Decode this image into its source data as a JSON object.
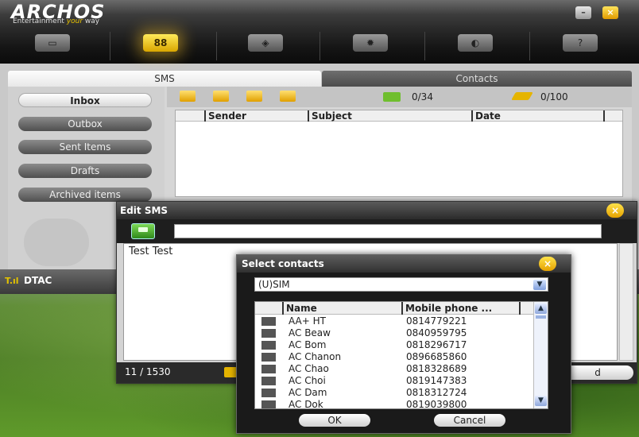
{
  "app": {
    "logo": "ARCHOS",
    "tagline_pre": "Entertainment ",
    "tagline_em": "your",
    "tagline_post": " way",
    "minimize_glyph": "–",
    "close_glyph": "×"
  },
  "toolbar": {
    "items": [
      {
        "name": "monitor-icon",
        "glyph": "▭"
      },
      {
        "name": "sms-icon",
        "glyph": "88",
        "active": true
      },
      {
        "name": "package-icon",
        "glyph": "◈"
      },
      {
        "name": "settings-icon",
        "glyph": "✹"
      },
      {
        "name": "sync-icon",
        "glyph": "◐"
      },
      {
        "name": "help-icon",
        "glyph": "?"
      }
    ]
  },
  "tabs": {
    "sms": "SMS",
    "contacts": "Contacts"
  },
  "folders": [
    "Inbox",
    "Outbox",
    "Sent Items",
    "Drafts",
    "Archived items"
  ],
  "counters": {
    "sim": "0/34",
    "phone": "0/100"
  },
  "message_columns": [
    "Sender",
    "Subject",
    "Date"
  ],
  "status": {
    "signal": "T.ıl",
    "carrier": "DTAC"
  },
  "edit_sms": {
    "title": "Edit SMS",
    "recipient": "",
    "body": "Test Test",
    "char_count": "11 / 1530",
    "send_label": "d"
  },
  "select_contacts": {
    "title": "Select contacts",
    "source": "(U)SIM",
    "columns": [
      "Name",
      "Mobile  phone ..."
    ],
    "contacts": [
      {
        "name": "AA+ HT",
        "phone": "0814779221"
      },
      {
        "name": "AC Beaw",
        "phone": "0840959795"
      },
      {
        "name": "AC Bom",
        "phone": "0818296717"
      },
      {
        "name": "AC Chanon",
        "phone": "0896685860"
      },
      {
        "name": "AC Chao",
        "phone": "0818328689"
      },
      {
        "name": "AC Choi",
        "phone": "0819147383"
      },
      {
        "name": "AC Dam",
        "phone": "0818312724"
      },
      {
        "name": "AC Dok",
        "phone": "0819039800"
      }
    ],
    "ok_label": "OK",
    "cancel_label": "Cancel"
  },
  "colors": {
    "accent": "#e4a100",
    "sim_green": "#6fbe2e"
  }
}
